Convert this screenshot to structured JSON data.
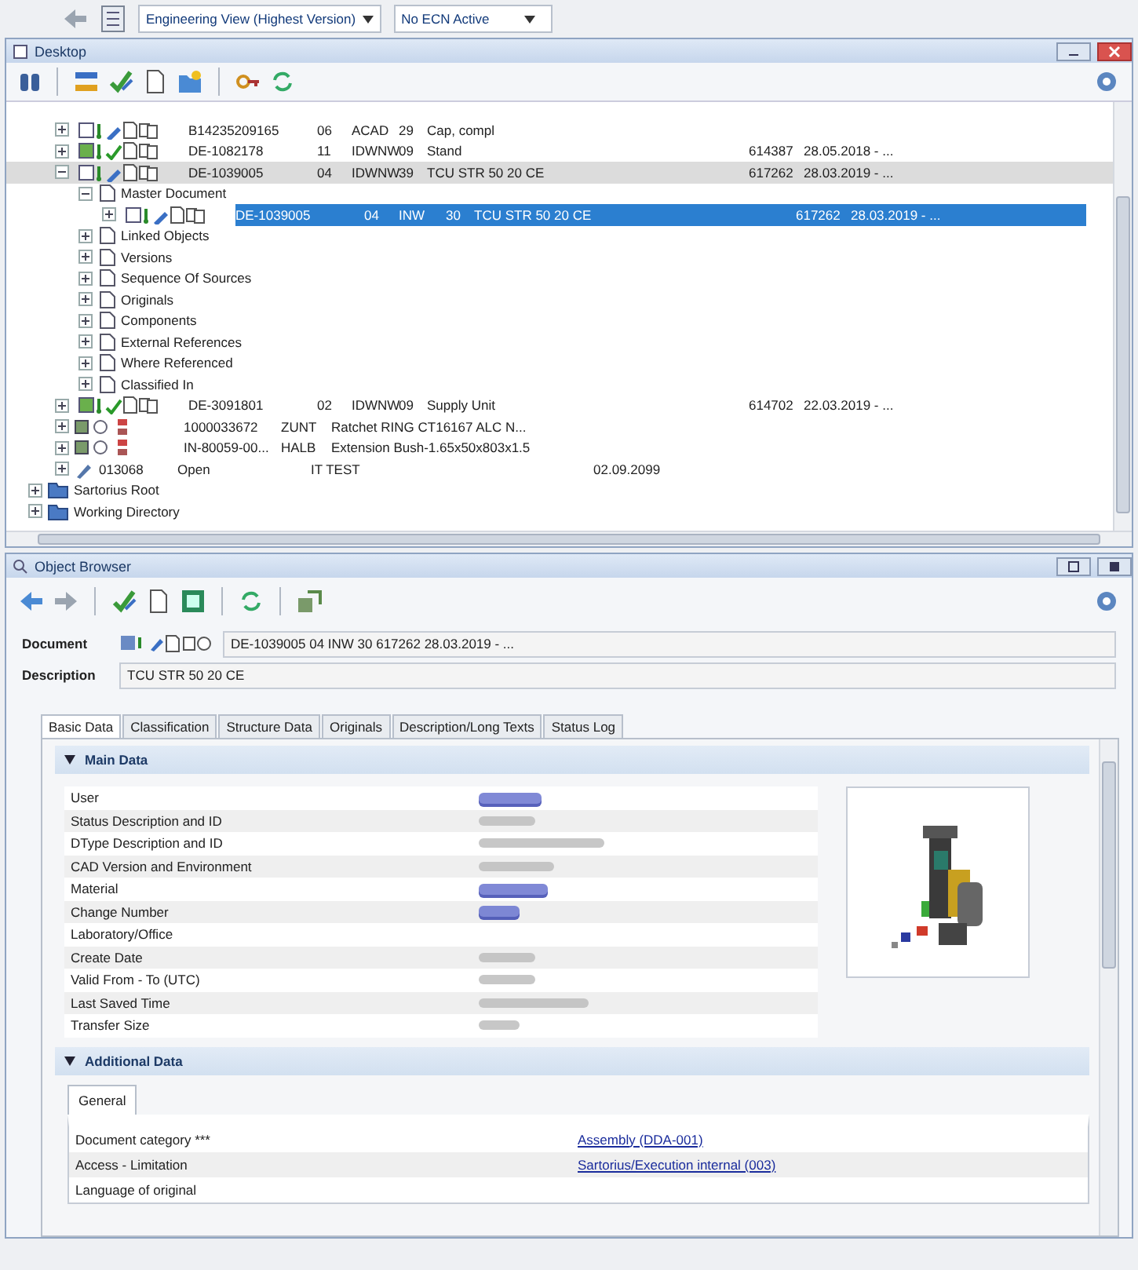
{
  "toolbar": {
    "view": "Engineering View (Highest Version)",
    "ecn": "No ECN Active"
  },
  "desktop": {
    "title": "Desktop",
    "tree": [
      {
        "kind": "document",
        "released": false,
        "expanded": false,
        "highlighted": false,
        "selected": false,
        "cells": [
          "B14235209165",
          "06",
          "ACAD",
          "29",
          "Cap, compl"
        ]
      },
      {
        "kind": "document",
        "released": true,
        "expanded": false,
        "highlighted": false,
        "selected": false,
        "cells": [
          "DE-1082178",
          "11",
          "IDWNW",
          "09",
          "Stand",
          "614387",
          "28.05.2018 - ..."
        ]
      },
      {
        "kind": "document",
        "released": false,
        "expanded": true,
        "highlighted": true,
        "selected": false,
        "cells": [
          "DE-1039005",
          "04",
          "IDWNW",
          "39",
          "TCU STR 50 20 CE",
          "617262",
          "28.03.2019 - ..."
        ],
        "children": [
          {
            "kind": "node",
            "label": "Master Document",
            "expanded": true,
            "children": [
              {
                "kind": "document",
                "released": false,
                "expanded": false,
                "highlighted": false,
                "selected": true,
                "cells": [
                  "DE-1039005",
                  "04",
                  "INW",
                  "30",
                  "TCU STR 50 20 CE",
                  "617262",
                  "28.03.2019 - ..."
                ]
              }
            ]
          },
          {
            "kind": "node",
            "label": "Linked Objects",
            "expanded": false
          },
          {
            "kind": "node",
            "label": "Versions",
            "expanded": false
          },
          {
            "kind": "node",
            "label": "Sequence Of Sources",
            "expanded": false
          },
          {
            "kind": "node",
            "label": "Originals",
            "expanded": false
          },
          {
            "kind": "node",
            "label": "Components",
            "expanded": false
          },
          {
            "kind": "node",
            "label": "External References",
            "expanded": false
          },
          {
            "kind": "node",
            "label": "Where Referenced",
            "expanded": false
          },
          {
            "kind": "node",
            "label": "Classified In",
            "expanded": false
          }
        ]
      },
      {
        "kind": "document",
        "released": true,
        "expanded": false,
        "highlighted": false,
        "selected": false,
        "cells": [
          "DE-3091801",
          "02",
          "IDWNW",
          "09",
          "Supply Unit",
          "614702",
          "22.03.2019 - ..."
        ]
      },
      {
        "kind": "material",
        "expanded": false,
        "cells": [
          "1000033672",
          "ZUNT",
          "Ratchet RING CT16167 ALC N..."
        ]
      },
      {
        "kind": "material",
        "expanded": false,
        "cells": [
          "IN-80059-00...",
          "HALB",
          "Extension Bush-1.65x50x803x1.5"
        ]
      },
      {
        "kind": "change",
        "expanded": false,
        "cells": [
          "013068",
          "Open",
          "IT TEST",
          "02.09.2099"
        ]
      },
      {
        "kind": "root",
        "label": "Sartorius Root",
        "expanded": false
      },
      {
        "kind": "root",
        "label": "Working Directory",
        "expanded": false
      }
    ]
  },
  "browser": {
    "title": "Object Browser",
    "document_label": "Document",
    "document_value": "DE-1039005 04 INW 30 617262 28.03.2019 - ...",
    "description_label": "Description",
    "description_value": "TCU STR 50 20 CE",
    "tabs": [
      {
        "label": "Basic Data",
        "selected": true
      },
      {
        "label": "Classification",
        "selected": false
      },
      {
        "label": "Structure Data",
        "selected": false
      },
      {
        "label": "Originals",
        "selected": false
      },
      {
        "label": "Description/Long Texts",
        "selected": false
      },
      {
        "label": "Status Log",
        "selected": false
      }
    ],
    "main_data": {
      "title": "Main Data",
      "expanded": true,
      "rows": [
        {
          "label": "User",
          "has_value": true,
          "link": true
        },
        {
          "label": "Status Description and ID",
          "has_value": true,
          "link": false
        },
        {
          "label": "DType Description and ID",
          "has_value": true,
          "link": false
        },
        {
          "label": "CAD Version and Environment",
          "has_value": true,
          "link": false
        },
        {
          "label": "Material",
          "has_value": true,
          "link": true
        },
        {
          "label": "Change Number",
          "has_value": true,
          "link": true
        },
        {
          "label": "Laboratory/Office",
          "has_value": false
        },
        {
          "label": "Create Date",
          "has_value": true,
          "link": false
        },
        {
          "label": "Valid From - To (UTC)",
          "has_value": true,
          "link": false
        },
        {
          "label": "Last Saved Time",
          "has_value": true,
          "link": false
        },
        {
          "label": "Transfer Size",
          "has_value": true,
          "link": false
        }
      ]
    },
    "additional_data": {
      "title": "Additional Data",
      "expanded": true,
      "tabs": [
        {
          "label": "General",
          "selected": true
        }
      ],
      "rows": [
        {
          "label": "Document category ***",
          "value": "Assembly (DDA-001)"
        },
        {
          "label": "Access - Limitation",
          "value": "Sartorius/Execution internal (003)"
        },
        {
          "label": "Language of original"
        }
      ]
    }
  }
}
